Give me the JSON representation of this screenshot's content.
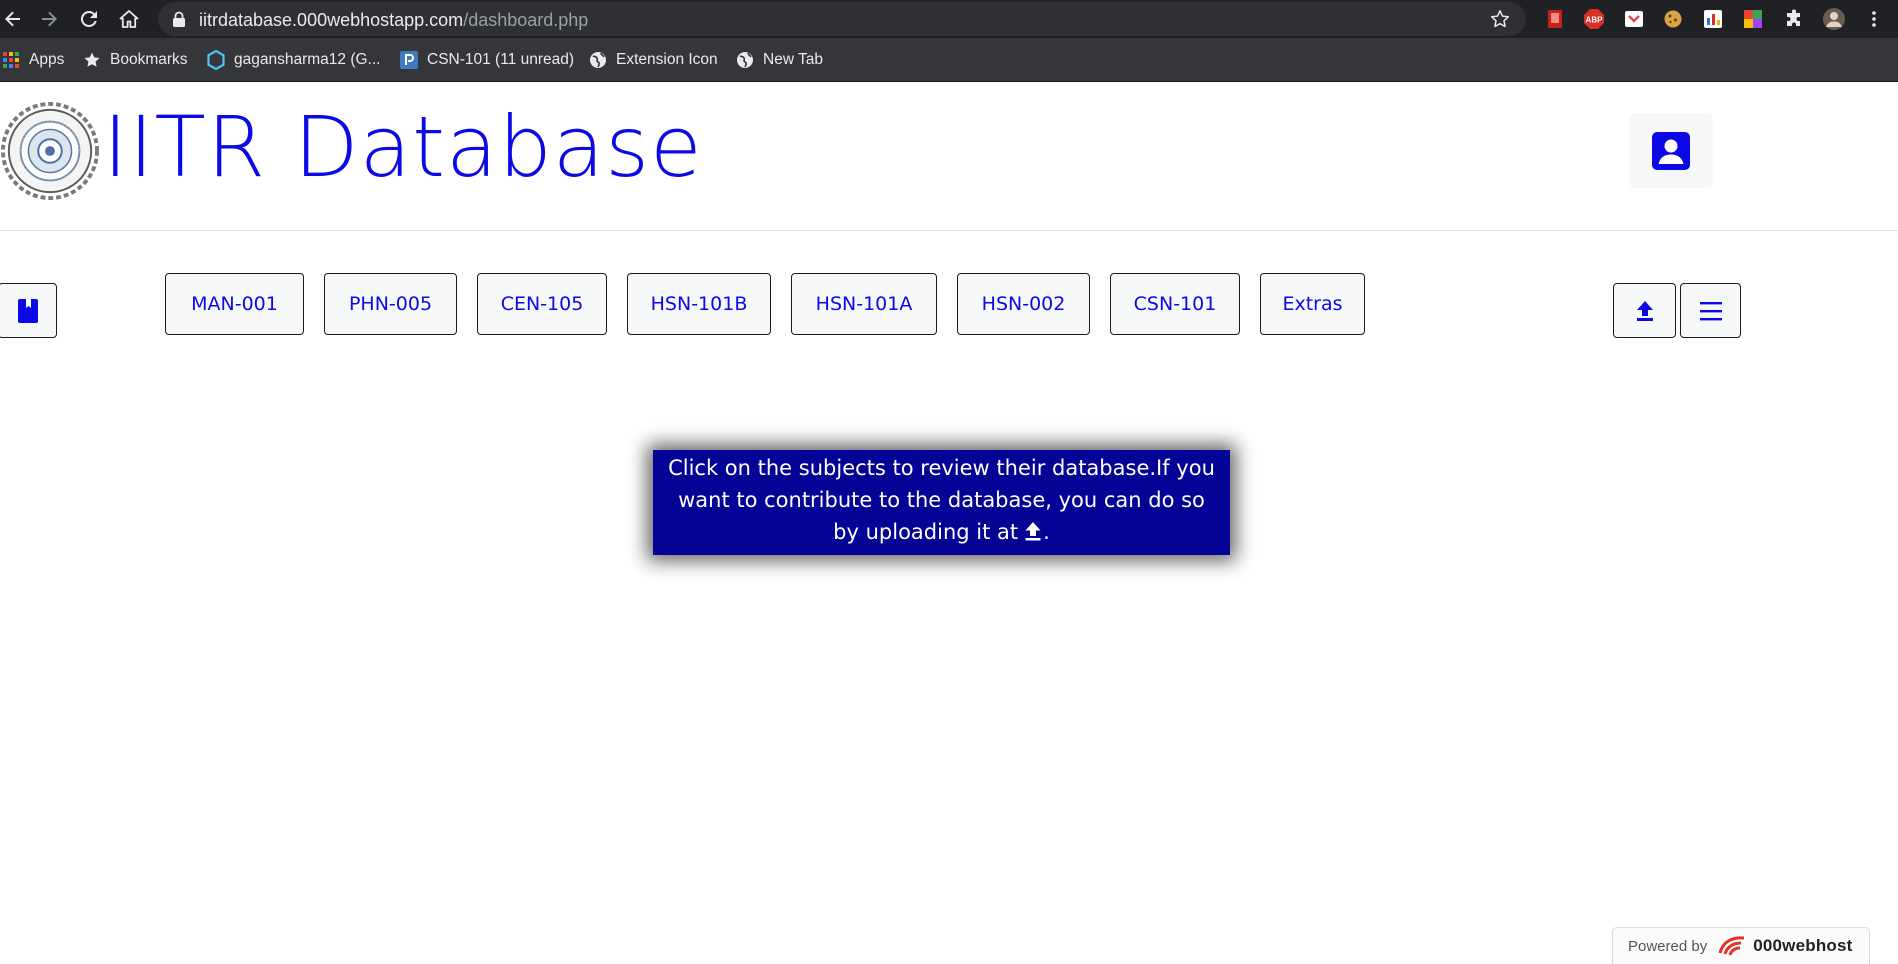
{
  "browser": {
    "url_host": "iitrdatabase.000webhostapp.com",
    "url_path": "/dashboard.php",
    "bookmarks": [
      {
        "label": "Apps",
        "icon": "apps-grid-icon"
      },
      {
        "label": "Bookmarks",
        "icon": "star-icon"
      },
      {
        "label": "gagansharma12 (G...",
        "icon": "hexagon-icon"
      },
      {
        "label": "CSN-101 (11 unread)",
        "icon": "piazza-icon"
      },
      {
        "label": "Extension Icon",
        "icon": "globe-icon"
      },
      {
        "label": "New Tab",
        "icon": "globe-icon"
      }
    ],
    "extensions": [
      "pdf-icon",
      "adblock-icon",
      "pocket-icon",
      "cookie-icon",
      "chart-icon",
      "palette-icon",
      "puzzle-icon",
      "avatar-icon",
      "kebab-menu-icon"
    ],
    "adblock_label": "ABP"
  },
  "header": {
    "title": "IITR Database",
    "logo_icon": "iitr-seal-icon",
    "profile_icon": "account-box-icon"
  },
  "subjects": [
    "MAN-001",
    "PHN-005",
    "CEN-105",
    "HSN-101B",
    "HSN-101A",
    "HSN-002",
    "CSN-101",
    "Extras"
  ],
  "side_buttons": {
    "left_icon": "book-icon",
    "upload_icon": "upload-icon",
    "menu_icon": "hamburger-icon"
  },
  "info": {
    "text": "Click on the subjects to review their database.If you want to contribute to the database, you can do so by uploading it at",
    "text_end": "."
  },
  "footer": {
    "powered_by": "Powered by",
    "brand": "000webhost"
  },
  "colors": {
    "accent": "#0d09e6",
    "info_bg": "#040395",
    "chrome_dark": "#202124"
  }
}
